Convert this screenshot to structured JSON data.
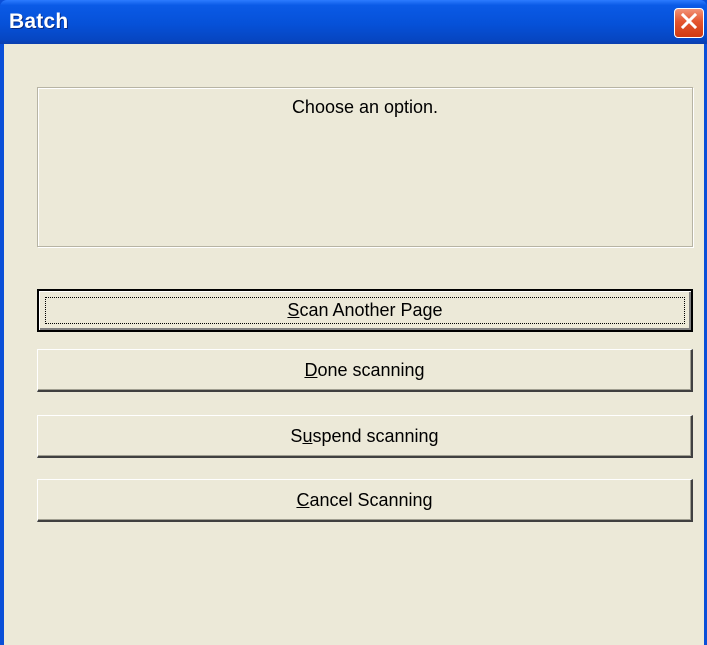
{
  "window": {
    "title": "Batch",
    "close_icon": "close-icon",
    "close_color": "#e4552f"
  },
  "message": {
    "text": "Choose an option."
  },
  "buttons": [
    {
      "label": "Scan Another Page",
      "mnemonic": "S",
      "rest": "can Another Page",
      "default": true
    },
    {
      "label": "Done scanning",
      "mnemonic": "D",
      "rest": "one scanning",
      "default": false
    },
    {
      "label": "Suspend scanning",
      "mnemonic_prefix": "S",
      "mnemonic": "u",
      "rest": "spend scanning",
      "default": false
    },
    {
      "label": "Cancel Scanning",
      "mnemonic": "C",
      "rest": "ancel Scanning",
      "default": false
    }
  ],
  "colors": {
    "titlebar": "#0651d8",
    "client": "#ece9d8"
  }
}
